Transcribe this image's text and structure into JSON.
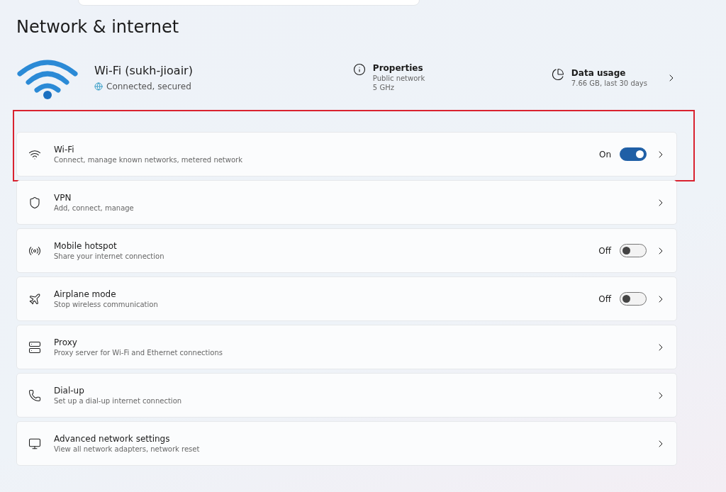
{
  "page_title": "Network & internet",
  "connection": {
    "name": "Wi-Fi (sukh-jioair)",
    "status": "Connected, secured"
  },
  "properties": {
    "title": "Properties",
    "lines": [
      "Public network",
      "5 GHz"
    ]
  },
  "data_usage": {
    "title": "Data usage",
    "detail": "7.66 GB, last 30 days"
  },
  "items": [
    {
      "kind": "wifi",
      "title": "Wi-Fi",
      "subtitle": "Connect, manage known networks, metered network",
      "toggle_label": "On",
      "on": true,
      "highlighted": true
    },
    {
      "kind": "vpn",
      "title": "VPN",
      "subtitle": "Add, connect, manage",
      "highlighted": false
    },
    {
      "kind": "hotspot",
      "title": "Mobile hotspot",
      "subtitle": "Share your internet connection",
      "toggle_label": "Off",
      "on": false,
      "highlighted": false
    },
    {
      "kind": "airplane",
      "title": "Airplane mode",
      "subtitle": "Stop wireless communication",
      "toggle_label": "Off",
      "on": false,
      "highlighted": false
    },
    {
      "kind": "proxy",
      "title": "Proxy",
      "subtitle": "Proxy server for Wi-Fi and Ethernet connections",
      "highlighted": false
    },
    {
      "kind": "dialup",
      "title": "Dial-up",
      "subtitle": "Set up a dial-up internet connection",
      "highlighted": false
    },
    {
      "kind": "advanced",
      "title": "Advanced network settings",
      "subtitle": "View all network adapters, network reset",
      "highlighted": false
    }
  ]
}
